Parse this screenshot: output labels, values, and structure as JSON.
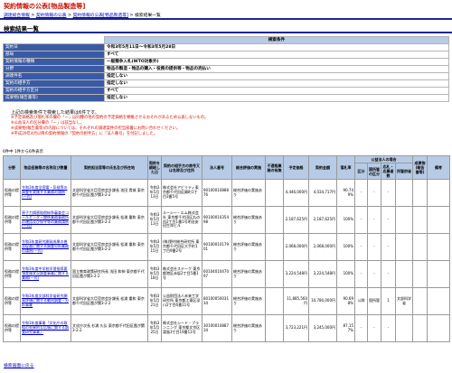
{
  "header": {
    "title": "契約情報の公表[物品製造等]",
    "breadcrumbs": [
      "調達総合情報",
      "契約情報の公表",
      "契約情報の公表[物品製造等]"
    ],
    "separator": ">",
    "current_page": "検索結果一覧"
  },
  "heading": "検索結果一覧",
  "conditions": {
    "section_title": "検索条件",
    "rows": [
      {
        "label": "契約日",
        "value": "令和3年5月11日〜令和3年5月28日"
      },
      {
        "label": "部局",
        "value": "すべて"
      },
      {
        "label": "契約情報の種類",
        "value": "一般競争入札(WTO対象外)"
      },
      {
        "label": "分野",
        "value": "物品の製造・物品の購入・役務の提供等・物品の売払い"
      },
      {
        "label": "調達件名",
        "value": "指定しない"
      },
      {
        "label": "契約の相手方",
        "value": "指定しない"
      },
      {
        "label": "契約の相手方区分",
        "value": "すべて"
      },
      {
        "label": "成果物(報告書等)",
        "value": "指定しない"
      }
    ]
  },
  "notes": {
    "summary": "上記の検索条件で検索した結果は6件です。",
    "lines": [
      "※予定価格及び落札率の欄の「ー」は同種の他の契約の予定価格を類推させるおそれがあるため公表しないもの。",
      "※公益法人の区分欄の「ー」は該当なし。",
      "※成果物(報告書等)の内容については、それぞれの調達案件の担当部署にお問い合わせください。",
      "※平成29年4月以降の契約情報の「契約の相手方」に「法人番号」を付記しました。"
    ]
  },
  "count_text": "6件中 1件から6件表示",
  "results": {
    "columns": [
      "分野",
      "物品役務等の名称及び数量",
      "契約担当官等の氏名及び所在地",
      "契約を締結した日",
      "契約の相手方の商号又は名称及び住所",
      "法人番号",
      "総合評価の実施",
      "不適格業務の有無",
      "予定価格",
      "契約金額",
      "落札率",
      "区分",
      "国所管の区分",
      "応札・応募者数",
      "所管府省",
      "成果物(報告書等)",
      "備考"
    ],
    "group_header": "公益法人の場合",
    "rows": [
      {
        "field": "役務の提供等",
        "item": "令和3年度全国電・気候等の調査を実施する業務の請負(一式)",
        "officer": "文部科学省大臣官房会計課長 池田 貴城 東京都千代田区霞が関3-2-2",
        "date": "令和3年5月13日",
        "partner": "株式会社アビリティ東京都千代田区麹町1丁目3番5号",
        "corp_no": "9010001088876",
        "eval": "総合評価の実施あり",
        "unfit": "",
        "planned": "4,446,000円",
        "amount": "4,034,717円",
        "rate": "90.749%",
        "kubun": "-",
        "kokushokan": "-",
        "bidders": "-",
        "ministry": "",
        "output": "",
        "remarks": ""
      },
      {
        "field": "役務の提供等",
        "item": "原子力損害賠償紛争審査会コールセンター関係業務事務所の運用及び保守等の業務請負(一式)",
        "officer": "文部科学省大臣官房会計課長 松浦 重和 東京都千代田区霞が関3-2-2",
        "date": "令和3年5月13日",
        "partner": "ルーシー・エム株式会社 東京都千代田区丸の内2丁目1番1号明治安田生命ビル",
        "corp_no": "9010001035498",
        "eval": "総合評価の実施あり",
        "unfit": "",
        "planned": "2,187,625円",
        "amount": "2,187,625円",
        "rate": "100%",
        "kubun": "-",
        "kokushokan": "-",
        "bidders": "-",
        "ministry": "",
        "output": "",
        "remarks": ""
      },
      {
        "field": "役務の提供等",
        "item": "令和3年度研究開発成果の普及促進に関する調査分析業務の請負(一式)",
        "officer": "文部科学省大臣官房会計課長 松浦 重和 東京都千代田区霞が関3-2-2",
        "date": "令和3年5月15日",
        "partner": "(株)野村総合研究所 東京都千代田区大手町1丁目9番2号",
        "corp_no": "9010001017901",
        "eval": "総合評価の実施あり",
        "unfit": "",
        "planned": "2,068,000円",
        "amount": "2,068,000円",
        "rate": "100%",
        "kubun": "-",
        "kokushokan": "-",
        "bidders": "-",
        "ministry": "",
        "output": "",
        "remarks": ""
      },
      {
        "field": "役務の提供等",
        "item": "令和3年度中学校学習指導要領実施状況調査事業に関する業務(一式)",
        "officer": "国立教育政策研究所長 浅田 和伸 東京都千代田区霞が関3-2-2",
        "date": "令和3年5月18日",
        "partner": "株式会社ステーク 東京都港区赤坂2丁目5番1号",
        "corp_no": "6010401047097",
        "eval": "総合評価の実施あり",
        "unfit": "",
        "planned": "3,224,548円",
        "amount": "3,224,548円",
        "rate": "100%",
        "kubun": "-",
        "kokushokan": "-",
        "bidders": "-",
        "ministry": "",
        "output": "",
        "remarks": ""
      },
      {
        "field": "役務の提供等",
        "item": "令和3年度文部科学省研究開発評価に関する動向調査・分析事業",
        "officer": "文部科学省大臣官房会計課長 松浦 重和 東京都千代田区霞が関3-2-2",
        "date": "令和3年5月21日",
        "partner": "公益財団法人未来工学研究所 東京都江東区深川2丁目6番11号",
        "corp_no": "8010005003134",
        "eval": "総合評価の実施あり",
        "unfit": "",
        "planned": "11,885,560円",
        "amount": "10,780,000円",
        "rate": "90.698%",
        "kubun": "公財",
        "kokushokan": "国所管",
        "bidders": "1",
        "ministry": "文部科学省",
        "output": "",
        "remarks": ""
      },
      {
        "field": "役務の提供等",
        "item": "令和3年度事業「文化庁の取組の効果的な広報に関する調査研究事業」",
        "officer": "文化庁次長 杉浦 久弘 東京都千代田区霞が関3-2-2",
        "date": "令和3年5月25日",
        "partner": "株式会社シード・プランニング 東京都文京区湯島3丁目19番11号",
        "corp_no": "3010001088734",
        "eval": "総合評価の実施あり",
        "unfit": "",
        "planned": "3,723,221円",
        "amount": "3,245,000円",
        "rate": "87.157%",
        "kubun": "-",
        "kokushokan": "-",
        "bidders": "-",
        "ministry": "",
        "output": "",
        "remarks": ""
      }
    ]
  },
  "back_link": "検索画面に戻る"
}
